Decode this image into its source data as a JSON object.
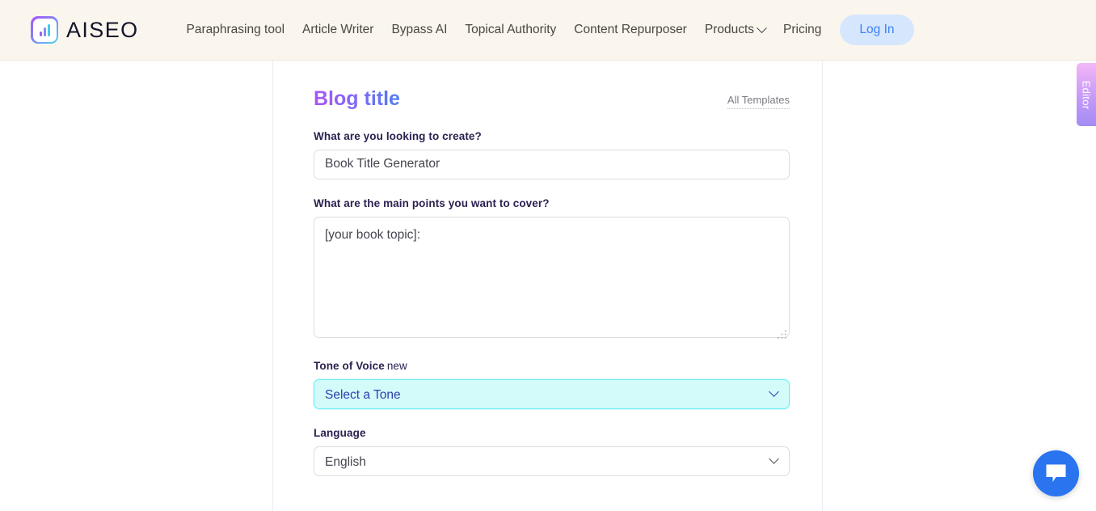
{
  "header": {
    "brand": {
      "name": "AISEO",
      "logo_icon": "aiseo-bar-chart-logo"
    },
    "nav_items": [
      {
        "label": "Paraphrasing tool",
        "has_caret": false
      },
      {
        "label": "Article Writer",
        "has_caret": false
      },
      {
        "label": "Bypass AI",
        "has_caret": false
      },
      {
        "label": "Topical Authority",
        "has_caret": false
      },
      {
        "label": "Content Repurposer",
        "has_caret": false
      },
      {
        "label": "Products",
        "has_caret": true
      },
      {
        "label": "Pricing",
        "has_caret": false
      }
    ],
    "login_label": "Log In"
  },
  "panel": {
    "title": "Blog title",
    "all_templates_label": "All Templates",
    "fields": {
      "looking_to_create": {
        "label": "What are you looking to create?",
        "value": "Book Title Generator",
        "placeholder": "What are you looking to create?"
      },
      "main_points": {
        "label": "What are the main points you want to cover?",
        "value": "[your book topic]:",
        "placeholder": "What are the main points you want to cover?"
      },
      "tone_of_voice": {
        "label": "Tone of Voice",
        "badge": "new",
        "value": "Select a Tone"
      },
      "language": {
        "label": "Language",
        "value": "English"
      }
    }
  },
  "editor_tab": {
    "label": "Editor"
  },
  "chat": {
    "icon": "chat-bubble-icon"
  },
  "colors": {
    "header_bg": "#faf6ee",
    "login_bg": "#d6e6fd",
    "login_text": "#3b82f6",
    "title_gradient_start": "#a855f7",
    "title_gradient_end": "#4f7bf0",
    "tone_bg": "#d2fbfa",
    "tone_border": "#6ff0f5",
    "tone_text": "#2f3fa8",
    "editor_tab_start": "#f4b6f7",
    "editor_tab_end": "#a38bf3",
    "chat_fab": "#2a74f0"
  }
}
